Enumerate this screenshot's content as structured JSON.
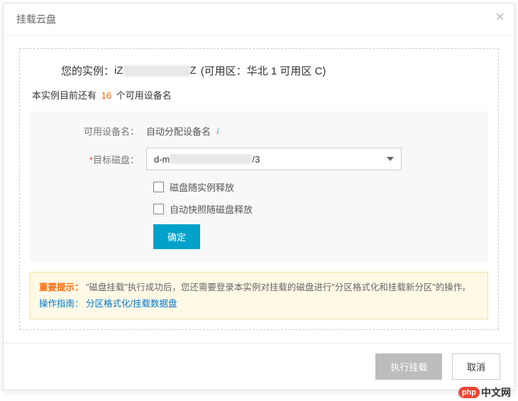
{
  "modal": {
    "title": "挂载云盘",
    "instance_label": "您的实例：",
    "instance_prefix": "iZ",
    "instance_suffix": "Z",
    "zone_text": "(可用区：华北 1 可用区 C)",
    "device_count_prefix": "本实例目前还有",
    "device_count_value": "16",
    "device_count_suffix": "个可用设备名",
    "form": {
      "device_label": "可用设备名：",
      "device_value": "自动分配设备名",
      "target_label": "目标磁盘：",
      "target_value_prefix": "d-m",
      "target_value_suffix": "/3",
      "release_with_instance": "磁盘随实例释放",
      "release_snapshot": "自动快照随磁盘释放",
      "confirm": "确定"
    },
    "hint": {
      "strong": "重要提示：",
      "text1": "\"磁盘挂载\"执行成功后，您还需要登录本实例对挂载的磁盘进行\"分区格式化和挂载新分区\"的操作。",
      "guide_label": "操作指南：",
      "guide_link": "分区格式化/挂载数据盘"
    },
    "footer": {
      "execute": "执行挂载",
      "cancel": "取消"
    }
  },
  "watermark": {
    "badge": "php",
    "text": "中文网"
  }
}
